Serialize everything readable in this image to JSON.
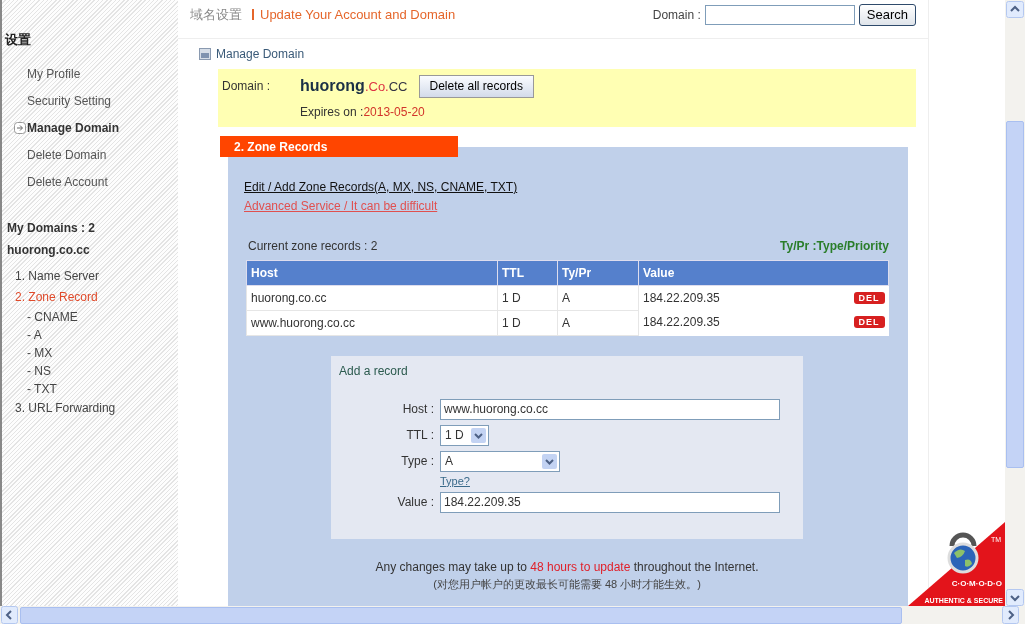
{
  "header": {
    "title_cn": "域名设置",
    "title": "Update Your Account and Domain",
    "search_label": "Domain :",
    "search_button": "Search"
  },
  "sidebar": {
    "heading": "设置",
    "items": [
      {
        "label": "My Profile",
        "selected": false
      },
      {
        "label": "Security Setting",
        "selected": false
      },
      {
        "label": "Manage Domain",
        "selected": true
      },
      {
        "label": "Delete Domain",
        "selected": false
      },
      {
        "label": "Delete Account",
        "selected": false
      }
    ],
    "domains_count": "My Domains : 2",
    "domain": "huorong.co.cc",
    "domain_items": [
      {
        "label": "1. Name Server",
        "selected": false
      },
      {
        "label": "2. Zone Record",
        "selected": true,
        "children": [
          {
            "label": "- CNAME"
          },
          {
            "label": "- A"
          },
          {
            "label": "- MX"
          },
          {
            "label": "- NS"
          },
          {
            "label": "- TXT"
          }
        ]
      },
      {
        "label": "3. URL Forwarding",
        "selected": false
      }
    ]
  },
  "main": {
    "section_title": "Manage Domain",
    "domain_box": {
      "label": "Domain :",
      "name": "huorong",
      "name_mid": ".Co.",
      "name_end": "CC",
      "button": "Delete all records",
      "expires_label": "Expires on :",
      "expires_date": "2013-05-20"
    },
    "zone": {
      "tab": "2. Zone Records",
      "edit_link": "Edit / Add Zone Records(A, MX, NS, CNAME, TXT)",
      "advanced_link": "Advanced Service / It can be difficult",
      "count": "Current zone records : 2",
      "legend": "Ty/Pr :Type/Priority",
      "table": {
        "columns": [
          "Host",
          "TTL",
          "Ty/Pr",
          "Value"
        ],
        "rows": [
          {
            "cells": [
              "huorong.co.cc",
              "1 D",
              "A",
              "184.22.209.35"
            ],
            "action": "DEL"
          },
          {
            "cells": [
              "www.huorong.co.cc",
              "1 D",
              "A",
              "184.22.209.35"
            ],
            "action": "DEL"
          }
        ]
      },
      "form": {
        "title": "Add a record",
        "fields": [
          {
            "kind": "text",
            "label": "Host :",
            "value": "www.huorong.co.cc"
          },
          {
            "kind": "select",
            "label": "TTL :",
            "value": "1 D"
          },
          {
            "kind": "select",
            "label": "Type :",
            "value": "A",
            "help": "Type?"
          },
          {
            "kind": "text",
            "label": "Value :",
            "value": "184.22.209.35"
          }
        ]
      },
      "notice_before": "Any changes may take up to",
      "notice_highlight": "48 hours to update",
      "notice_after": "throughout the Internet.",
      "notice_cn": "(对您用户帐户的更改最长可能需要  48 小时才能生效。)"
    }
  },
  "seal": {
    "mark": "TM",
    "brand": "C·O·M·O·D·O",
    "tagline": "AUTHENTIC & SECURE"
  }
}
